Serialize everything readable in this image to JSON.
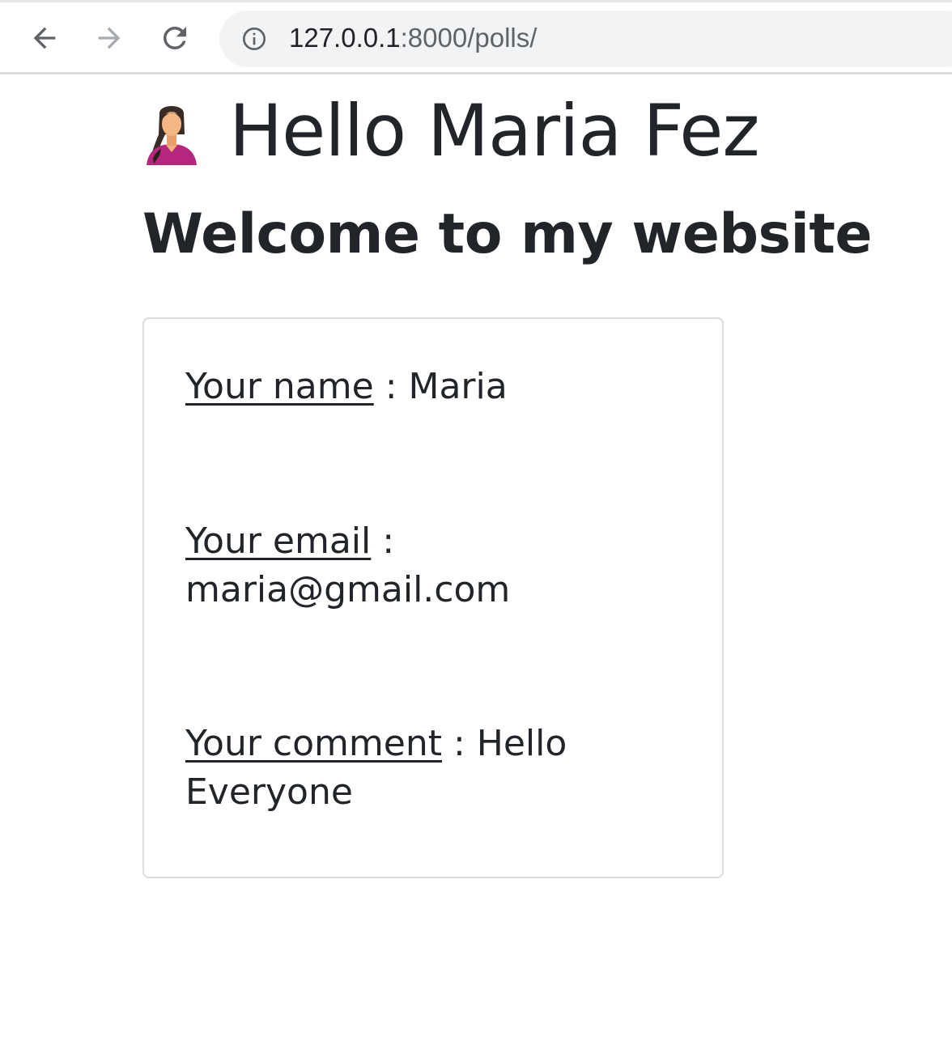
{
  "browser": {
    "url_host": "127.0.0.1",
    "url_path": ":8000/polls/",
    "back_icon": "arrow-left-icon",
    "forward_icon": "arrow-right-icon",
    "reload_icon": "reload-icon",
    "site_info_icon": "info-icon"
  },
  "header": {
    "avatar_icon": "female-avatar-icon",
    "greeting": "Hello Maria Fez",
    "welcome": "Welcome to my website"
  },
  "card": {
    "name_label": "Your name",
    "name_separator": " : ",
    "name_value": "Maria",
    "email_label": "Your email",
    "email_separator": " : ",
    "email_value": "maria@gmail.com",
    "comment_label": "Your comment",
    "comment_separator": " : ",
    "comment_value": "Hello Everyone"
  },
  "colors": {
    "text": "#212529",
    "omnibox": "#f1f3f4",
    "card_border": "#dcdcdc",
    "avatar_shirt": "#b5267e"
  }
}
